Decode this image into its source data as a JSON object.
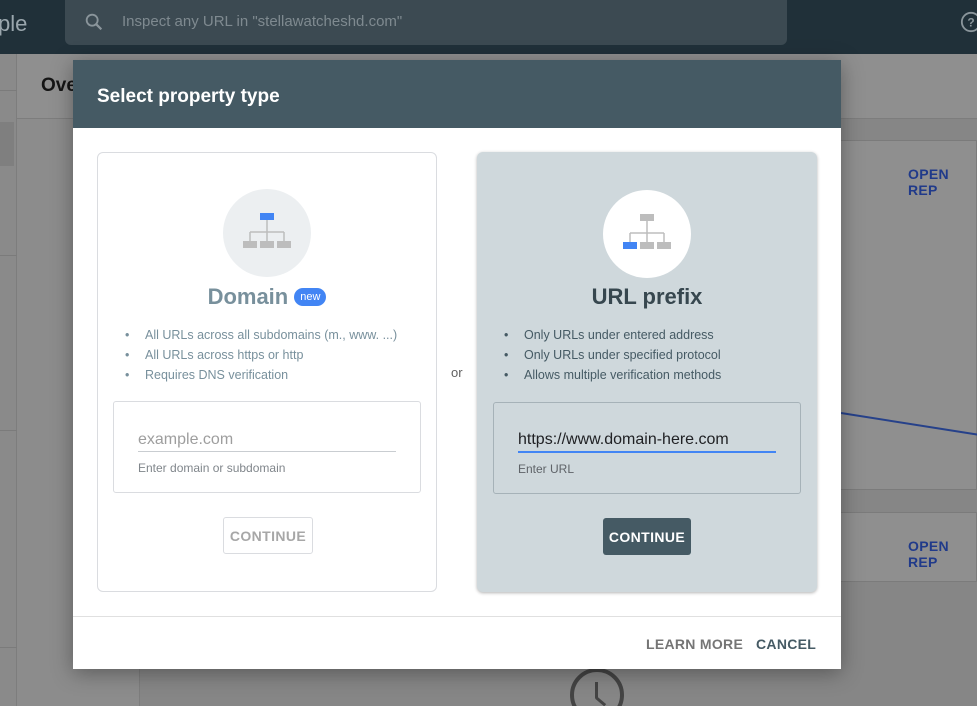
{
  "app": {
    "brand_fragment": "ple",
    "search_placeholder": "Inspect any URL in \"stellawatcheshd.com\"",
    "page_title_fragment": "Ove",
    "open_report_label_1": "OPEN REP",
    "open_report_label_2": "OPEN REP"
  },
  "dialog": {
    "title": "Select property type",
    "separator": "or",
    "domain_card": {
      "title": "Domain",
      "badge": "new",
      "features": [
        "All URLs across all subdomains (m., www. ...)",
        "All URLs across https or http",
        "Requires DNS verification"
      ],
      "input_placeholder": "example.com",
      "input_value": "",
      "helper": "Enter domain or subdomain",
      "continue_label": "CONTINUE"
    },
    "url_card": {
      "title": "URL prefix",
      "features": [
        "Only URLs under entered address",
        "Only URLs under specified protocol",
        "Allows multiple verification methods"
      ],
      "input_value": "https://www.domain-here.com",
      "helper": "Enter URL",
      "continue_label": "CONTINUE"
    },
    "footer": {
      "learn_more_label": "LEARN MORE",
      "cancel_label": "CANCEL"
    }
  },
  "colors": {
    "header_bg": "#455a64",
    "accent_blue": "#4285f4",
    "selected_card_bg": "#cfd8dc"
  },
  "icons": {
    "search": "search-icon",
    "help": "help-icon",
    "sitemap": "sitemap-icon",
    "clock": "clock-icon"
  }
}
